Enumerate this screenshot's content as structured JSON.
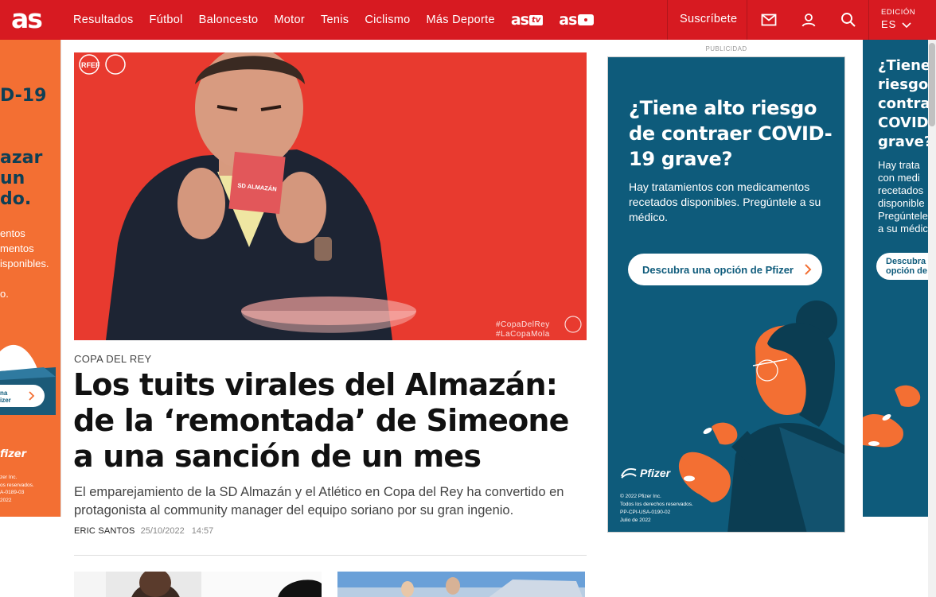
{
  "nav": {
    "logo": "as",
    "items": [
      "Resultados",
      "Fútbol",
      "Baloncesto",
      "Motor",
      "Tenis",
      "Ciclismo",
      "Más Deporte"
    ],
    "brand_tv": "as",
    "brand_tv_badge": "tv",
    "brand_photo": "as",
    "subscribe": "Suscríbete",
    "icons": [
      "mail-icon",
      "user-icon",
      "search-icon"
    ],
    "edition_label": "EDICIÓN",
    "edition_value": "ES",
    "bg_color": "#d71a21"
  },
  "article": {
    "kicker": "COPA DEL REY",
    "headline": "Los tuits virales del Almazán: de la ‘remontada’ de Simeone a una sanción de un mes",
    "summary": "El emparejamiento de la SD Almazán y el Atlético en Copa del Rey ha convertido en protagonista al community manager del equipo soriano por su gran ingenio.",
    "author": "ERIC SANTOS",
    "date": "25/10/2022",
    "time": "14:57",
    "image_caption_lines": [
      "#CopaDelRey",
      "#LaCopaMola"
    ],
    "card_text": "SD ALMAZÁN",
    "logo_text": "RFEF"
  },
  "ad": {
    "label": "PUBLICIDAD",
    "title": "¿Tiene alto riesgo de contraer COVID-19 grave?",
    "body": "Hay tratamientos con medicamentos recetados disponibles. Pregúntele a su médico.",
    "cta": "Descubra una opción de Pfizer",
    "brand": "Pfizer",
    "legal": [
      "© 2022 Pfizer Inc.",
      "Todos los derechos reservados.",
      "PP-CPI-USA-0190-02",
      "Julio de 2022"
    ],
    "bg_color": "#0e5b7b",
    "accent_color": "#f36f33"
  },
  "ad_left": {
    "title_lines": [
      "D-19",
      "",
      "azar",
      "un",
      "do."
    ],
    "body_lines": [
      "entos",
      "mentos",
      "isponibles."
    ],
    "tail": "o.",
    "cta_lines": [
      "na",
      "izer"
    ],
    "brand": "fizer",
    "legal": [
      "zer Inc.",
      "os reservados.",
      "A-0189-03",
      "2022"
    ]
  },
  "ad_right": {
    "title_lines": [
      "¿Tiene",
      "riesgo",
      "contra",
      "COVID",
      "grave?"
    ],
    "body_lines": [
      "Hay trata",
      "con medi",
      "recetados",
      "disponible",
      "Pregúntele",
      "a su médico"
    ],
    "cta_lines": [
      "Descubra",
      "opción de"
    ]
  }
}
